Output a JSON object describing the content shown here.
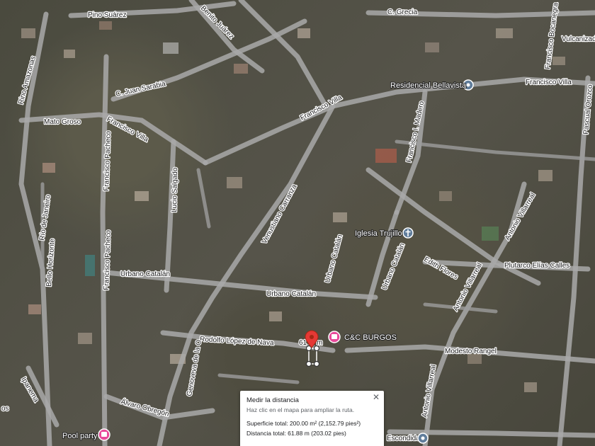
{
  "streets": {
    "pino_suarez": "Pino Suárez",
    "benito_juarez": "Benito Juárez",
    "c_grecia": "C. Grecia",
    "francisco_bocanegra": "Francisco Bocanegra",
    "vulcanizado": "Vulcanizad",
    "rino_amazonas": "Rino Amazonas",
    "c_juan_sarabia": "C. Juan Sarabia",
    "mato_groso": "Mato Groso",
    "francisco_villa_left": "Francisco Villa",
    "francisco_villa_center": "Francisco Villa",
    "francisco_villa_right": "Francisco Villa",
    "francisco_i_madero": "Francisco I. Madero",
    "pascual_orozco": "Pascual Orozco",
    "francisco_pacheco_top": "Francisco Pacheco",
    "francisco_pacheco_bottom": "Francisco Pacheco",
    "lucio_salgado": "Lucio Salgado",
    "venustiano_carranza": "Venustiano Carranza",
    "rio_de_janeiro": "Río de Janeiro",
    "bello_horizonte": "Bello Horizonte",
    "antonio_villarreal_top": "Antonio Villarreal",
    "antonio_villarreal_mid": "Antonio Villarreal",
    "antonio_villarreal_bottom": "Antonio Villarreal",
    "plutarco_elias_calles": "Plutarco Elías Calles",
    "urbano_catalan_left": "Urbano Catalán",
    "urbano_catalan_center": "Urbano Catalán",
    "urbano_catalan_diag": "Urbano Catalán",
    "urbano_catalan_diag2": "Urbano Catalán",
    "urbano_catalan_small": "Urbano Catalán",
    "edith_flores": "Edith Flores",
    "rodolfo_lopez_de_nava": "Rodolfo López de Nava",
    "genoveva_de_la_o": "Genoveva de la O",
    "modesto_rangel": "Modesto Rangel",
    "ipanema": "Ipanema",
    "alvaro_obregon": "Álvaro Obregón",
    "escondida": "Escondida",
    "os": "os"
  },
  "pois": {
    "residencial_bellavista": "Residencial Bellavista",
    "iglesia_trujillo": "Iglesia Trujillo",
    "cc_burgos": "C&C BURGOS",
    "pool_party": "Pool party"
  },
  "measurement": {
    "marker_label": "61",
    "marker_label_suffix": "m",
    "panel": {
      "title": "Medir la distancia",
      "hint": "Haz clic en el mapa para ampliar la ruta.",
      "area": "Superficie total: 200.00 m² (2,152.79 pies²)",
      "distance": "Distancia total: 61.88 m (203.02 pies)",
      "close_symbol": "✕"
    }
  },
  "colors": {
    "marker_red": "#e53935",
    "poi_pink": "#e84a9a",
    "poi_blue_gray": "#607d9b",
    "road": "#a9a9a9"
  }
}
